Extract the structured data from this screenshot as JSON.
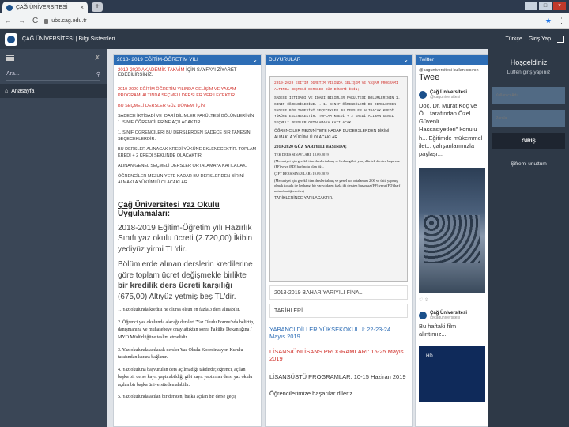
{
  "browser": {
    "tab_title": "ÇAĞ ÜNİVERSİTESİ",
    "tab_close": "×",
    "new_tab": "+",
    "url": "ubs.cag.edu.tr",
    "nav_back": "←",
    "nav_forward": "→",
    "nav_reload": "C",
    "star": "★",
    "menu": "⋮",
    "win_min": "–",
    "win_max": "□",
    "win_close": "×"
  },
  "header": {
    "title": "ÇAĞ ÜNİVERSİTESİ | Bilgi Sistemleri",
    "lang": "Türkçe",
    "login_logout": "Giriş Yap"
  },
  "sidebar": {
    "search_placeholder": "Ara...",
    "home": "Anasayfa"
  },
  "col1": {
    "heading": "2018- 2019 EĞİTİM-ÖĞRETİM YILI",
    "top_link": "2019-2020 AKADEMİK TAKVİM",
    "top_rest": "İÇİN SAYFAYI ZİYARET EDEBİLİRSİNİZ.",
    "p1": "2019-2020 EĞİTİM ÖĞRETİM YILINDA GELİŞİM VE YAŞAM PROGRAMI ALTINDA SEÇMELİ DERSLER VERİLECEKTİR.",
    "p2": "BU SEÇMELİ DERSLER GÜZ DÖNEMİ İÇİN;",
    "p3": "SADECE İKTİSADİ VE İDARİ BİLİMLER FAKÜLTESİ BÖLÜMLERİNİN 1. SINIF ÖĞRENCİLERİNE AÇILACAKTIR.",
    "p4": "1. SINIF ÖĞRENCİLERİ BU DERSLERDEN SADECE BİR TANESİNİ SEÇECEKLERDİR.",
    "p5": "BU DERSLER ALINACAK KREDİ YÜKÜNE EKLENECEKTİR. TOPLAM KREDİ + 2 KREDİ ŞEKLİNDE OLACAKTIR.",
    "p6": "ALINAN GENEL SEÇMELİ DERSLER ORTALAMAYA KATILACAK.",
    "p7": "ÖĞRENCİLER MEZUNİYETE KADAR BU DERSLERDEN BİRİNİ ALMAKLA YÜKÜMLÜ OLACAKLAR.",
    "summer_title": "Çağ Üniversitesi Yaz Okulu Uygulamaları:",
    "summer_p1": "2018-2019 Eğitim-Öğretim yılı Hazırlık Sınıfı yaz okulu ücreti (2.720,00) İkibin yediyüz yirmi TL'dir.",
    "summer_p2_a": "Bölümlerde alınan derslerin kredilerine göre toplam ücret değişmekle birlikte",
    "summer_p2_b": "bir kredilik ders ücreti karşılığı",
    "summer_p2_c": "(675,00) Altıyüz yetmiş beş TL'dir.",
    "items": [
      "1.   Yaz okulunda kredisi ne olursa olsun en fazla 3 ders alınabilir.",
      "2.   Öğrenci yaz okulunda alacağı dersleri 'Yaz Okulu Formu'nda belirtip, danışmanına ve muhasebeye onaylattıktan sonra Fakülte Dekanlığına / MYO Müdürlüğüne teslim etmelidir.",
      "3.   Yaz okulunda açılacak dersler Yaz Okulu Koordinasyon Kurulu tarafından karara bağlanır.",
      "4.   Yaz okuluna başvurulan ders açılmadığı takdirde; öğrenci, açılan başka bir derse kayıt yaptırabildiği gibi kayıt yaptırılan dersi yaz okulu açılan bir başka üniversiteden alabilir.",
      "5.   Yaz okulunda açılan bir dersten, başka açılan bir derse geçiş"
    ]
  },
  "col2": {
    "heading": "DUYURULAR",
    "box_mono_1": "2019-2020 EĞİTİM ÖĞRETİM YILINDA GELİŞİM VE YAŞAM PROGRAMI ALTINDA SEÇMELİ DERSLER GÜZ DÖNEMİ İÇİN;",
    "box_mono_2": "SADECE İKTİSADİ VE İDARİ BİLİMLER FAKÜLTESİ BÖLÜMLERİNİN 1. SINIF ÖĞRENCİLERİNE... 1. SINIF ÖĞRENCİLERİ BU DERSLERDEN SADECE BİR TANESİNİ SEÇECEKLER BU DERSLER ALINACAK KREDİ YÜKÜNE EKLENECEKTİR. TOPLAM KREDİ + 2 KREDİ ALINAN GENEL SEÇMELİ DERSLER ORTALAMAYA KATILACAK.",
    "box_sans": "ÖĞRENCİLER MEZUNİYETE KADAR BU DERSLERDEN BİRİNİ ALMAKLA YÜKÜMLÜ OLACAKLAR.",
    "box_red_head": "2019-2020 GÜZ YARIYILI BAŞINDA;",
    "box_red_1": "TEK DERS SINAVLARI: 18.09.2019",
    "box_serif_1": "(Mezuniyet için gerekli tüm dersleri almış ve herhangi bir yarıyılda tek dersten başarısız (FF) veya (FD) harf notu olan öğ...",
    "box_red_2": "ÇİFT DERS SINAVLARI:19.09.2019",
    "box_serif_2": "(Mezuniyet için gerekli tüm dersleri almış ve genel not ortalaması 2.00 ve üstü yapmış olmak koşulu ile herhangi bir yarıyılda en fazla iki dersten başarısız (FF) veya (FD) harf notu olan öğrenciler)",
    "box_red_3": "TARİHLERİNDE YAPILACAKTIR.",
    "row1": "2018-2019 BAHAR YARIYILI FİNAL",
    "row2": "TARİHLERİ",
    "line1": "YABANCI DİLLER YÜKSEKOKULU: 22-23-24 Mayıs 2019",
    "line2": "LİSANS/ÖNLİSANS PROGRAMLARI: 15-25 Mayıs 2019",
    "line3": "LİSANSÜSTÜ PROGRAMLAR: 10-15 Haziran 2019",
    "line4": "Öğrencilerimize başarılar dileriz."
  },
  "col3": {
    "heading": "Twitter",
    "intro_small": "@caguniversitesi kullanıcısının",
    "intro_big": "Twee",
    "tweet1_name": "Çağ Üniversitesi",
    "tweet1_handle": "@caguniversitesi",
    "tweet1_text": "Doç. Dr. Murat Koç ve Ö... tarafından Özel Güvenli... Hassasiyetleri\" konulu h... Eğitimde mükemmel ilet... çalışanlarımızla paylaşı...",
    "tweet1_actions": "♡   ⇪",
    "tweet2_name": "Çağ Üniversitesi",
    "tweet2_handle": "@caguniversitesi",
    "tweet2_text": "Bu haftaki film alıntımız...",
    "video_label": "HD"
  },
  "login": {
    "title": "Hoşgeldiniz",
    "subtitle": "Lütfen giriş yapınız",
    "username_placeholder": "Kullanıcı Adı",
    "password_placeholder": "Parola",
    "submit": "GİRİŞ",
    "forgot": "Şifremi unuttum"
  }
}
